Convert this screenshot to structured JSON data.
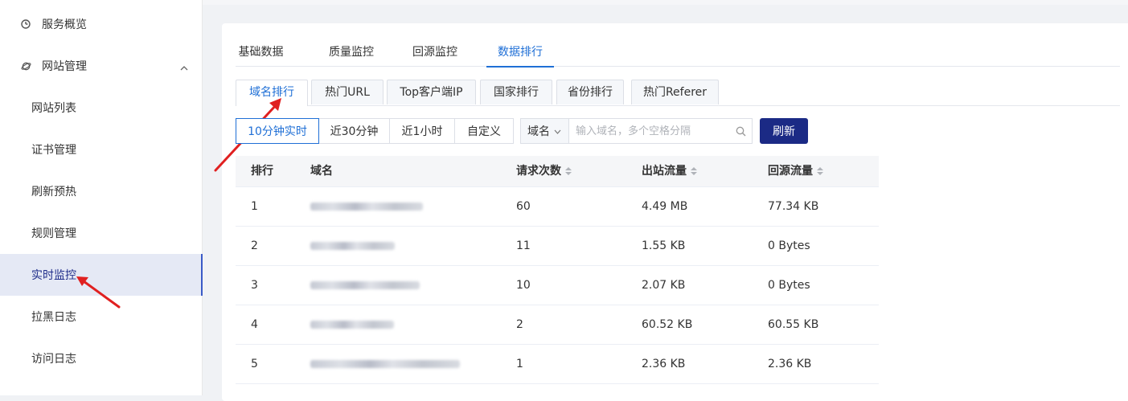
{
  "sidebar": {
    "top_items": [
      {
        "label": "服务概览",
        "icon": "dashboard-icon"
      },
      {
        "label": "网站管理",
        "icon": "globe-icon",
        "expanded": true
      }
    ],
    "sub_items": [
      {
        "label": "网站列表"
      },
      {
        "label": "证书管理"
      },
      {
        "label": "刷新预热"
      },
      {
        "label": "规则管理"
      },
      {
        "label": "实时监控",
        "active": true
      },
      {
        "label": "拉黑日志"
      },
      {
        "label": "访问日志"
      }
    ]
  },
  "tabs_primary": [
    {
      "label": "基础数据"
    },
    {
      "label": "质量监控"
    },
    {
      "label": "回源监控"
    },
    {
      "label": "数据排行",
      "active": true
    }
  ],
  "tabs_secondary": [
    {
      "label": "域名排行",
      "active": true
    },
    {
      "label": "热门URL"
    },
    {
      "label": "Top客户端IP"
    },
    {
      "label": "国家排行"
    },
    {
      "label": "省份排行"
    },
    {
      "label": "热门Referer"
    }
  ],
  "time_range": [
    {
      "label": "10分钟实时",
      "active": true
    },
    {
      "label": "近30分钟"
    },
    {
      "label": "近1小时"
    },
    {
      "label": "自定义"
    }
  ],
  "search": {
    "select_value": "域名",
    "placeholder": "输入域名，多个空格分隔"
  },
  "refresh_label": "刷新",
  "table": {
    "headers": {
      "rank": "排行",
      "domain": "域名",
      "requests": "请求次数",
      "outbound": "出站流量",
      "backsource": "回源流量"
    },
    "rows": [
      {
        "rank": "1",
        "domain": "",
        "requests": "60",
        "outbound": "4.49 MB",
        "backsource": "77.34 KB"
      },
      {
        "rank": "2",
        "domain": "",
        "requests": "11",
        "outbound": "1.55 KB",
        "backsource": "0 Bytes"
      },
      {
        "rank": "3",
        "domain": "",
        "requests": "10",
        "outbound": "2.07 KB",
        "backsource": "0 Bytes"
      },
      {
        "rank": "4",
        "domain": "",
        "requests": "2",
        "outbound": "60.52 KB",
        "backsource": "60.55 KB"
      },
      {
        "rank": "5",
        "domain": "",
        "requests": "1",
        "outbound": "2.36 KB",
        "backsource": "2.36 KB"
      }
    ]
  },
  "colors": {
    "accent": "#1f6fd6",
    "primary_button": "#1b2a85",
    "active_menu_bg": "#e5e9f5",
    "annotation_arrow": "#e02020"
  }
}
